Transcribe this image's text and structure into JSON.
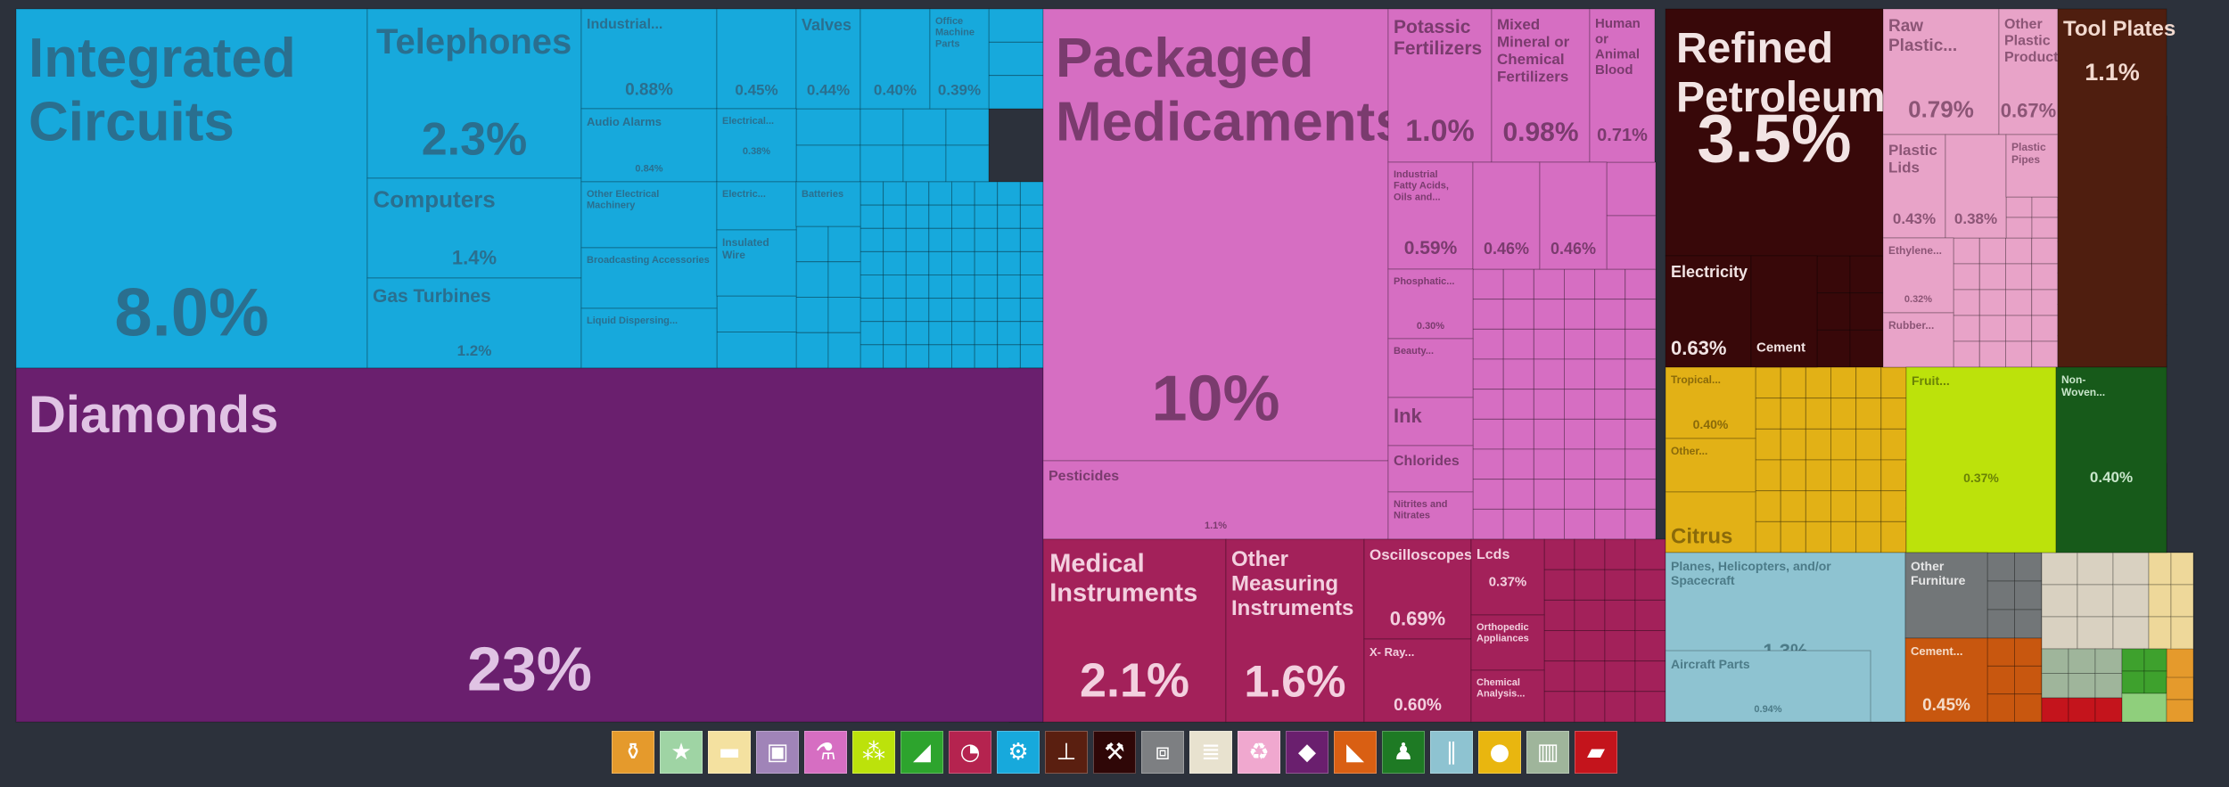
{
  "chart_data": {
    "type": "treemap",
    "groups": [
      {
        "name": "Machines",
        "color": "#17a9dc",
        "label_color": "#2a6f8f"
      },
      {
        "name": "Precious Metals",
        "color": "#6a1f6e",
        "label_color": "#e0c3e4"
      },
      {
        "name": "Chemical Products",
        "color": "#d66ec2",
        "label_color": "#7a3b6e"
      },
      {
        "name": "Instruments",
        "color": "#a3215a",
        "label_color": "#f3d0df"
      },
      {
        "name": "Mineral Products",
        "color": "#380809",
        "label_color": "#f2e4e4"
      },
      {
        "name": "Plastics and Rubbers",
        "color": "#e8a3c8",
        "label_color": "#8c5576"
      },
      {
        "name": "Metals",
        "color": "#4f1e0f",
        "label_color": "#f2d9cf"
      },
      {
        "name": "Vegetable Products",
        "color": "#e2b116",
        "label_color": "#8a6a0a"
      },
      {
        "name": "Vegetable Products 2",
        "color": "#bce20b",
        "label_color": "#6a8206"
      },
      {
        "name": "Textiles",
        "color": "#175a1a",
        "label_color": "#c9e6cb"
      },
      {
        "name": "Transportation",
        "color": "#8ec3d1",
        "label_color": "#4c7b88"
      },
      {
        "name": "Miscellaneous",
        "color": "#727678",
        "label_color": "#e6e6e6"
      },
      {
        "name": "Stone And Glass",
        "color": "#c8570f",
        "label_color": "#f5dcc9"
      }
    ],
    "items": [
      {
        "name": "Integrated Circuits",
        "value": "8.0%",
        "group": 0
      },
      {
        "name": "Telephones",
        "value": "2.3%",
        "group": 0
      },
      {
        "name": "Computers",
        "value": "1.4%",
        "group": 0
      },
      {
        "name": "Gas Turbines",
        "value": "1.2%",
        "group": 0
      },
      {
        "name": "Industrial...",
        "value": "0.88%",
        "group": 0
      },
      {
        "name": "",
        "value": "0.45%",
        "group": 0
      },
      {
        "name": "Valves",
        "value": "0.44%",
        "group": 0
      },
      {
        "name": "",
        "value": "0.40%",
        "group": 0
      },
      {
        "name": "Office Machine Parts",
        "value": "0.39%",
        "group": 0
      },
      {
        "name": "Audio Alarms",
        "value": "0.84%",
        "group": 0
      },
      {
        "name": "Electrical...",
        "value": "0.38%",
        "group": 0
      },
      {
        "name": "Other Electrical Machinery",
        "value": "",
        "group": 0
      },
      {
        "name": "Electric...",
        "value": "",
        "group": 0
      },
      {
        "name": "Batteries",
        "value": "",
        "group": 0
      },
      {
        "name": "Broadcasting Accessories",
        "value": "",
        "group": 0
      },
      {
        "name": "Insulated Wire",
        "value": "",
        "group": 0
      },
      {
        "name": "Liquid Dispersing...",
        "value": "",
        "group": 0
      },
      {
        "name": "Diamonds",
        "value": "23%",
        "group": 1
      },
      {
        "name": "Packaged Medicaments",
        "value": "10%",
        "group": 2
      },
      {
        "name": "Pesticides",
        "value": "1.1%",
        "group": 2
      },
      {
        "name": "Potassic Fertilizers",
        "value": "1.0%",
        "group": 2
      },
      {
        "name": "Mixed Mineral or Chemical Fertilizers",
        "value": "0.98%",
        "group": 2
      },
      {
        "name": "Human or Animal Blood",
        "value": "0.71%",
        "group": 2
      },
      {
        "name": "Industrial Fatty Acids, Oils and...",
        "value": "0.59%",
        "group": 2
      },
      {
        "name": "",
        "value": "0.46%",
        "group": 2
      },
      {
        "name": "",
        "value": "0.46%",
        "group": 2
      },
      {
        "name": "Phosphatic...",
        "value": "0.30%",
        "group": 2
      },
      {
        "name": "Beauty...",
        "value": "",
        "group": 2
      },
      {
        "name": "Ink",
        "value": "",
        "group": 2
      },
      {
        "name": "Chlorides",
        "value": "",
        "group": 2
      },
      {
        "name": "Nitrites and Nitrates",
        "value": "",
        "group": 2
      },
      {
        "name": "Medical Instruments",
        "value": "2.1%",
        "group": 3
      },
      {
        "name": "Other Measuring Instruments",
        "value": "1.6%",
        "group": 3
      },
      {
        "name": "Oscilloscopes",
        "value": "0.69%",
        "group": 3
      },
      {
        "name": "X- Ray...",
        "value": "0.60%",
        "group": 3
      },
      {
        "name": "Lcds",
        "value": "0.37%",
        "group": 3
      },
      {
        "name": "Orthopedic Appliances",
        "value": "",
        "group": 3
      },
      {
        "name": "Chemical Analysis...",
        "value": "",
        "group": 3
      },
      {
        "name": "Refined Petroleum",
        "value": "3.5%",
        "group": 4
      },
      {
        "name": "Electricity",
        "value": "0.63%",
        "group": 4
      },
      {
        "name": "Cement",
        "value": "",
        "group": 4
      },
      {
        "name": "Raw Plastic...",
        "value": "0.79%",
        "group": 5
      },
      {
        "name": "Other Plastic Products",
        "value": "0.67%",
        "group": 5
      },
      {
        "name": "Plastic Lids",
        "value": "0.43%",
        "group": 5
      },
      {
        "name": "",
        "value": "0.38%",
        "group": 5
      },
      {
        "name": "Plastic Pipes",
        "value": "",
        "group": 5
      },
      {
        "name": "Ethylene...",
        "value": "0.32%",
        "group": 5
      },
      {
        "name": "Rubber...",
        "value": "",
        "group": 5
      },
      {
        "name": "Tool Plates",
        "value": "1.1%",
        "group": 6
      },
      {
        "name": "Tropical...",
        "value": "0.40%",
        "group": 7
      },
      {
        "name": "Other...",
        "value": "",
        "group": 7
      },
      {
        "name": "Citrus",
        "value": "",
        "group": 7
      },
      {
        "name": "Fruit...",
        "value": "0.37%",
        "group": 8
      },
      {
        "name": "Non-Woven...",
        "value": "0.40%",
        "group": 9
      },
      {
        "name": "Planes, Helicopters, and/or Spacecraft",
        "value": "1.3%",
        "group": 10
      },
      {
        "name": "Aircraft Parts",
        "value": "0.94%",
        "group": 10
      },
      {
        "name": "Other Furniture",
        "value": "",
        "group": 11
      },
      {
        "name": "Cement...",
        "value": "0.45%",
        "group": 12
      }
    ]
  },
  "legend": [
    {
      "icon": "bottle-icon",
      "glyph": "⚱",
      "color": "#e59a2c",
      "name": "legend-mineral-products"
    },
    {
      "icon": "star-icon",
      "glyph": "★",
      "color": "#9fd4a4",
      "name": "legend-animal-products"
    },
    {
      "icon": "cow-icon",
      "glyph": "▬",
      "color": "#f4e1a0",
      "name": "legend-animal-hides"
    },
    {
      "icon": "frame-icon",
      "glyph": "▣",
      "color": "#a084b8",
      "name": "legend-art-antiques"
    },
    {
      "icon": "flask-icon",
      "glyph": "⚗",
      "color": "#d66ec2",
      "name": "legend-chemical-products"
    },
    {
      "icon": "wheat-icon",
      "glyph": "⁂",
      "color": "#bce20b",
      "name": "legend-vegetable-products"
    },
    {
      "icon": "shoe-icon",
      "glyph": "◢",
      "color": "#2da42d",
      "name": "legend-footwear"
    },
    {
      "icon": "gauge-icon",
      "glyph": "◔",
      "color": "#b5234f",
      "name": "legend-instruments"
    },
    {
      "icon": "gears-icon",
      "glyph": "⚙",
      "color": "#17a9dc",
      "name": "legend-machines"
    },
    {
      "icon": "anvil-icon",
      "glyph": "⊥",
      "color": "#5a1f10",
      "name": "legend-metals"
    },
    {
      "icon": "pickaxe-icon",
      "glyph": "⚒",
      "color": "#2f0707",
      "name": "legend-minerals"
    },
    {
      "icon": "box-icon",
      "glyph": "⧈",
      "color": "#7d7f82",
      "name": "legend-miscellaneous"
    },
    {
      "icon": "paper-icon",
      "glyph": "≣",
      "color": "#e8e2cf",
      "name": "legend-paper-goods"
    },
    {
      "icon": "recycle-icon",
      "glyph": "♻",
      "color": "#f0a8cf",
      "name": "legend-plastics-rubbers"
    },
    {
      "icon": "gem-icon",
      "glyph": "◆",
      "color": "#6a1f6e",
      "name": "legend-precious-metals"
    },
    {
      "icon": "stone-icon",
      "glyph": "◣",
      "color": "#d95f13",
      "name": "legend-stone-glass"
    },
    {
      "icon": "shirt-icon",
      "glyph": "♟",
      "color": "#1e7a24",
      "name": "legend-textiles"
    },
    {
      "icon": "road-icon",
      "glyph": "∥",
      "color": "#8ec3d1",
      "name": "legend-transportation"
    },
    {
      "icon": "fruit-icon",
      "glyph": "●",
      "color": "#e9b60f",
      "name": "legend-foodstuffs"
    },
    {
      "icon": "weapons-icon",
      "glyph": "▥",
      "color": "#9fb59b",
      "name": "legend-weapons"
    },
    {
      "icon": "wood-icon",
      "glyph": "▰",
      "color": "#c4141c",
      "name": "legend-wood-products"
    }
  ]
}
